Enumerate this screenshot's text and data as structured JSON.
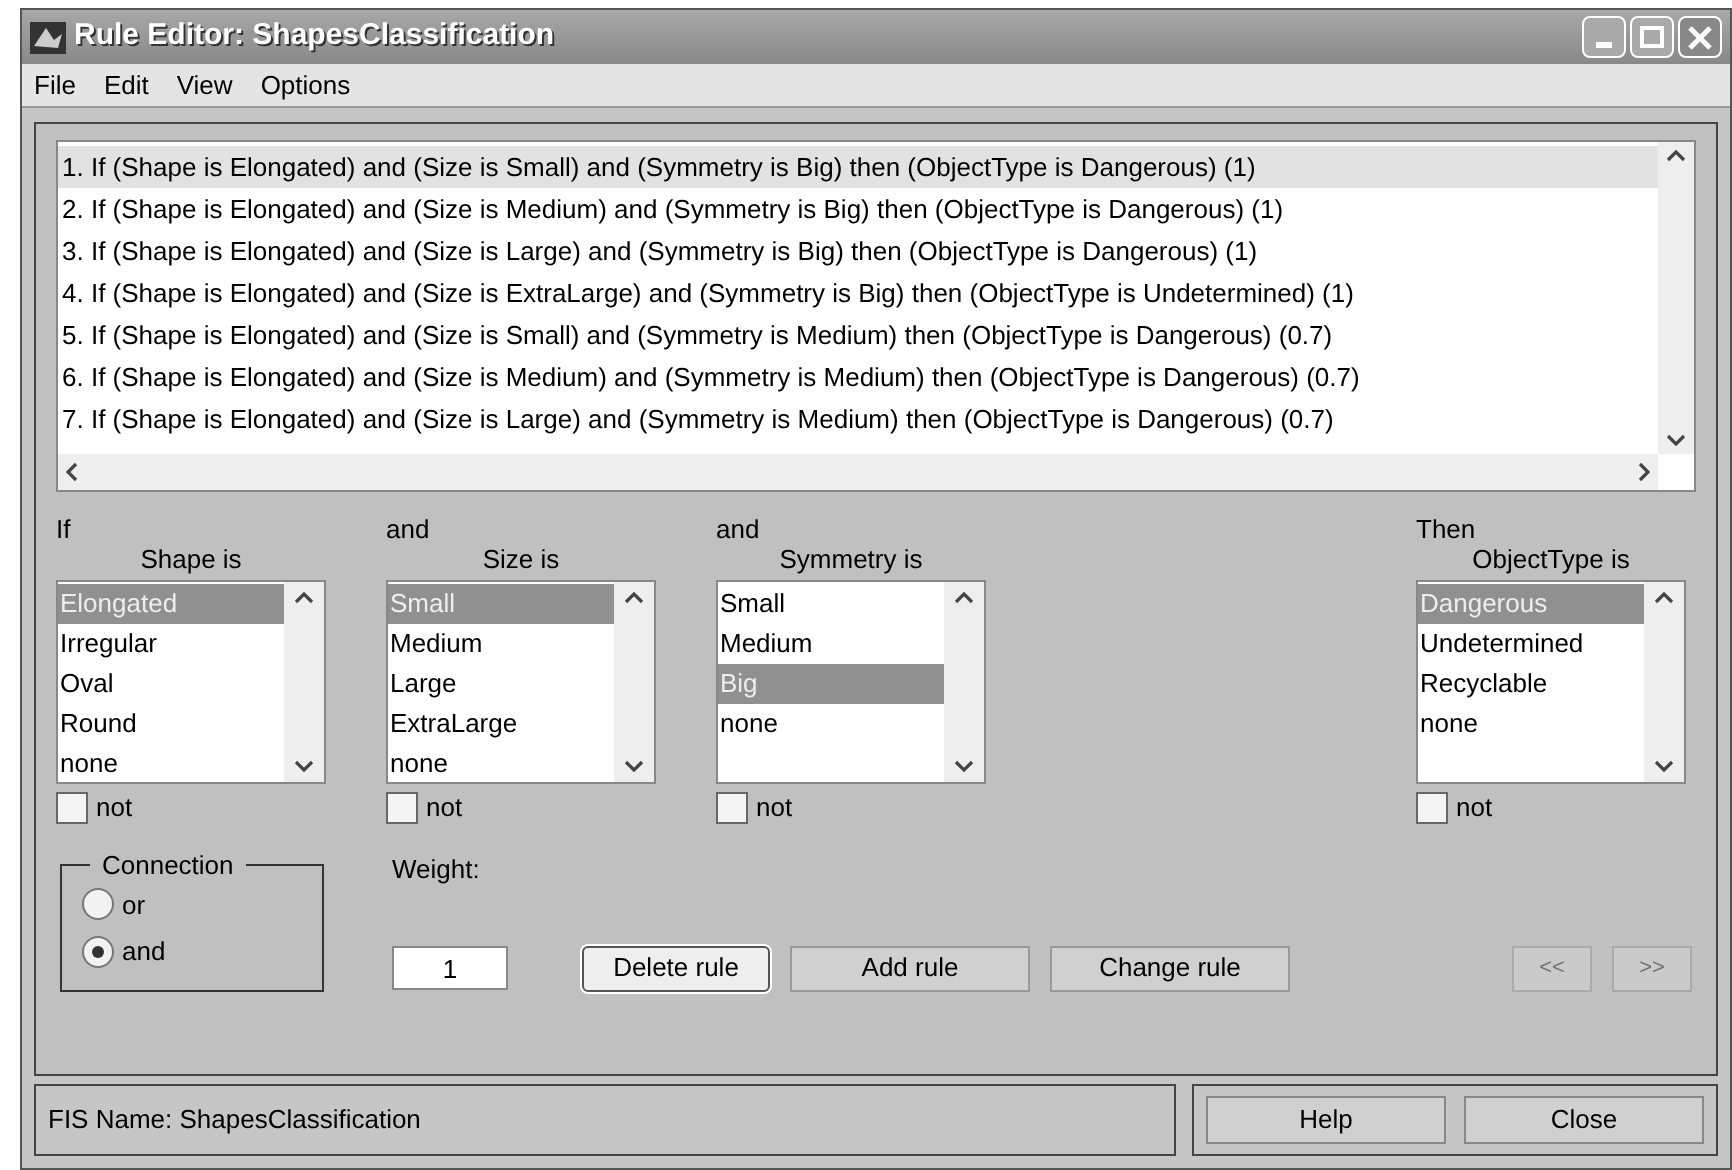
{
  "window": {
    "title": "Rule Editor: ShapesClassification"
  },
  "menu": [
    "File",
    "Edit",
    "View",
    "Options"
  ],
  "rules": [
    {
      "text": "1. If (Shape is Elongated) and (Size is Small) and (Symmetry is Big) then (ObjectType is Dangerous) (1)",
      "selected": true
    },
    {
      "text": "2. If (Shape is Elongated) and (Size is Medium) and (Symmetry is Big) then (ObjectType is Dangerous) (1)",
      "selected": false
    },
    {
      "text": "3. If (Shape is Elongated) and (Size is Large) and (Symmetry is Big) then (ObjectType is Dangerous) (1)",
      "selected": false
    },
    {
      "text": "4. If (Shape is Elongated) and (Size is ExtraLarge) and (Symmetry is Big) then (ObjectType is Undetermined) (1)",
      "selected": false
    },
    {
      "text": "5. If (Shape is Elongated) and (Size is Small) and (Symmetry is Medium) then (ObjectType is Dangerous) (0.7)",
      "selected": false
    },
    {
      "text": "6. If (Shape is Elongated) and (Size is Medium) and (Symmetry is Medium) then (ObjectType is Dangerous) (0.7)",
      "selected": false
    },
    {
      "text": "7. If (Shape is Elongated) and (Size is Large) and (Symmetry is Medium) then (ObjectType is Dangerous) (0.7)",
      "selected": false
    }
  ],
  "variables": [
    {
      "kind": "input",
      "prefix": "If",
      "label": "Shape is",
      "items": [
        {
          "label": "Elongated",
          "selected": true
        },
        {
          "label": "Irregular",
          "selected": false
        },
        {
          "label": "Oval",
          "selected": false
        },
        {
          "label": "Round",
          "selected": false
        },
        {
          "label": "none",
          "selected": false
        }
      ],
      "not": {
        "label": "not",
        "checked": false
      }
    },
    {
      "kind": "input",
      "prefix": "and",
      "label": "Size is",
      "items": [
        {
          "label": "Small",
          "selected": true
        },
        {
          "label": "Medium",
          "selected": false
        },
        {
          "label": "Large",
          "selected": false
        },
        {
          "label": "ExtraLarge",
          "selected": false
        },
        {
          "label": "none",
          "selected": false
        }
      ],
      "not": {
        "label": "not",
        "checked": false
      }
    },
    {
      "kind": "input",
      "prefix": "and",
      "label": "Symmetry is",
      "items": [
        {
          "label": "Small",
          "selected": false
        },
        {
          "label": "Medium",
          "selected": false
        },
        {
          "label": "Big",
          "selected": true
        },
        {
          "label": "none",
          "selected": false
        }
      ],
      "not": {
        "label": "not",
        "checked": false
      }
    },
    {
      "kind": "output",
      "prefix": "Then",
      "label": "ObjectType is",
      "items": [
        {
          "label": "Dangerous",
          "selected": true
        },
        {
          "label": "Undetermined",
          "selected": false
        },
        {
          "label": "Recyclable",
          "selected": false
        },
        {
          "label": "none",
          "selected": false
        }
      ],
      "not": {
        "label": "not",
        "checked": false
      }
    }
  ],
  "connection": {
    "title": "Connection",
    "options": [
      {
        "label": "or",
        "selected": false
      },
      {
        "label": "and",
        "selected": true
      }
    ]
  },
  "weight": {
    "label": "Weight:",
    "value": "1"
  },
  "actions": [
    {
      "label": "Delete rule",
      "kind": "raised"
    },
    {
      "label": "Add rule",
      "kind": "flat"
    },
    {
      "label": "Change rule",
      "kind": "flat"
    }
  ],
  "navigation": [
    {
      "label": "<<",
      "disabled": true
    },
    {
      "label": ">>",
      "disabled": true
    }
  ],
  "status": "FIS Name: ShapesClassification",
  "footer_buttons": [
    "Help",
    "Close"
  ]
}
